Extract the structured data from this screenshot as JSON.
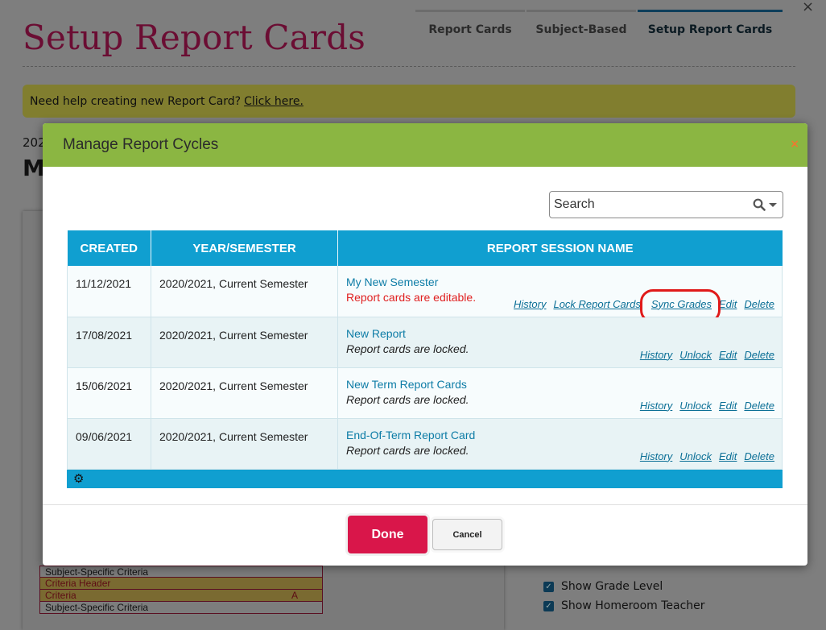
{
  "page": {
    "title": "Setup Report Cards",
    "tabs": [
      {
        "label": "Report Cards"
      },
      {
        "label": "Subject-Based"
      },
      {
        "label": "Setup Report Cards"
      }
    ],
    "close_glyph": "×",
    "help_text": "Need help creating new Report Card?",
    "help_link": "Click here.",
    "year_fragment": "202",
    "heading_fragment": "M"
  },
  "background_rows": [
    {
      "label": "Subject-Specific Criteria",
      "grade": ""
    },
    {
      "label": "Criteria Header",
      "grade": ""
    },
    {
      "label": "Criteria",
      "grade": "A"
    },
    {
      "label": "Subject-Specific Criteria",
      "grade": ""
    }
  ],
  "background_right": {
    "checkbox1": "Show Grade Level",
    "checkbox2": "Show Homeroom Teacher"
  },
  "modal": {
    "title": "Manage Report Cycles",
    "close_glyph": "×",
    "search_placeholder": "Search",
    "columns": {
      "created": "CREATED",
      "year": "YEAR/SEMESTER",
      "session": "REPORT SESSION NAME"
    },
    "rows": [
      {
        "created": "11/12/2021",
        "year": "2020/2021, Current Semester",
        "name": "My New Semester",
        "status": "Report cards are editable.",
        "actions": [
          "History",
          "Lock Report Cards",
          "Sync Grades",
          "Edit",
          "Delete"
        ]
      },
      {
        "created": "17/08/2021",
        "year": "2020/2021, Current Semester",
        "name": "New Report",
        "status": "Report cards are locked.",
        "actions": [
          "History",
          "Unlock",
          "Edit",
          "Delete"
        ]
      },
      {
        "created": "15/06/2021",
        "year": "2020/2021, Current Semester",
        "name": "New Term Report Cards",
        "status": "Report cards are locked.",
        "actions": [
          "History",
          "Unlock",
          "Edit",
          "Delete"
        ]
      },
      {
        "created": "09/06/2021",
        "year": "2020/2021, Current Semester",
        "name": "End-Of-Term Report Card",
        "status": "Report cards are locked.",
        "actions": [
          "History",
          "Unlock",
          "Edit",
          "Delete"
        ]
      }
    ],
    "done_label": "Done",
    "cancel_label": "Cancel"
  },
  "colors": {
    "header_green": "#8bb642",
    "table_blue": "#109fd0",
    "done_red": "#d9164a",
    "title_maroon": "#6b0d33"
  }
}
